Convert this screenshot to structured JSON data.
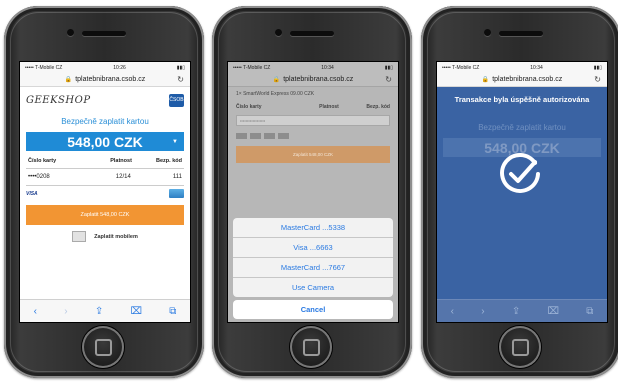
{
  "statusbar": {
    "carrier": "••••• T-Mobile CZ",
    "time_1": "10:26",
    "time_2": "10:34",
    "time_3": "10:34"
  },
  "url": "tplatebnibrana.csob.cz",
  "screen1": {
    "shop_logo": "GEEKSHOP",
    "bank_logo": "ČSOB",
    "pay_title": "Bezpečně zaplatit kartou",
    "amount": "548,00 CZK",
    "labels": {
      "card_number": "Číslo karty",
      "validity": "Platnost",
      "security_code": "Bezp. kód"
    },
    "values": {
      "card_number": "••••0208",
      "validity": "12/14",
      "security_code": "111"
    },
    "visa": "VISA",
    "pay_button": "Zaplatit 548,00 CZK",
    "mobile_pay": "Zaplatit mobilem"
  },
  "screen2": {
    "merchant_line": "1× SmartWorld Express 09.00 CZK",
    "labels": {
      "card_number": "Číslo karty",
      "validity": "Platnost",
      "security_code": "Bezp. kód"
    },
    "card_placeholder": "••••••••••••••••••",
    "pay_button": "Zaplatit 548,00 CZK",
    "options": [
      "MasterCard ...5338",
      "Visa ...6663",
      "MasterCard ...7667",
      "Use Camera"
    ],
    "cancel": "Cancel"
  },
  "screen3": {
    "message": "Transakce byla úspěšně autorizována",
    "bg_title": "Bezpečně zaplatit kartou",
    "bg_amount": "548,00 CZK"
  },
  "toolbar": {
    "back": "‹",
    "forward": "›",
    "share": "⇪",
    "bookmarks": "⌧",
    "tabs": "⧉"
  },
  "icons": {
    "lock": "lock-icon",
    "reload": "reload-icon",
    "check": "checkmark-circle-icon",
    "caret": "caret-down-icon"
  }
}
